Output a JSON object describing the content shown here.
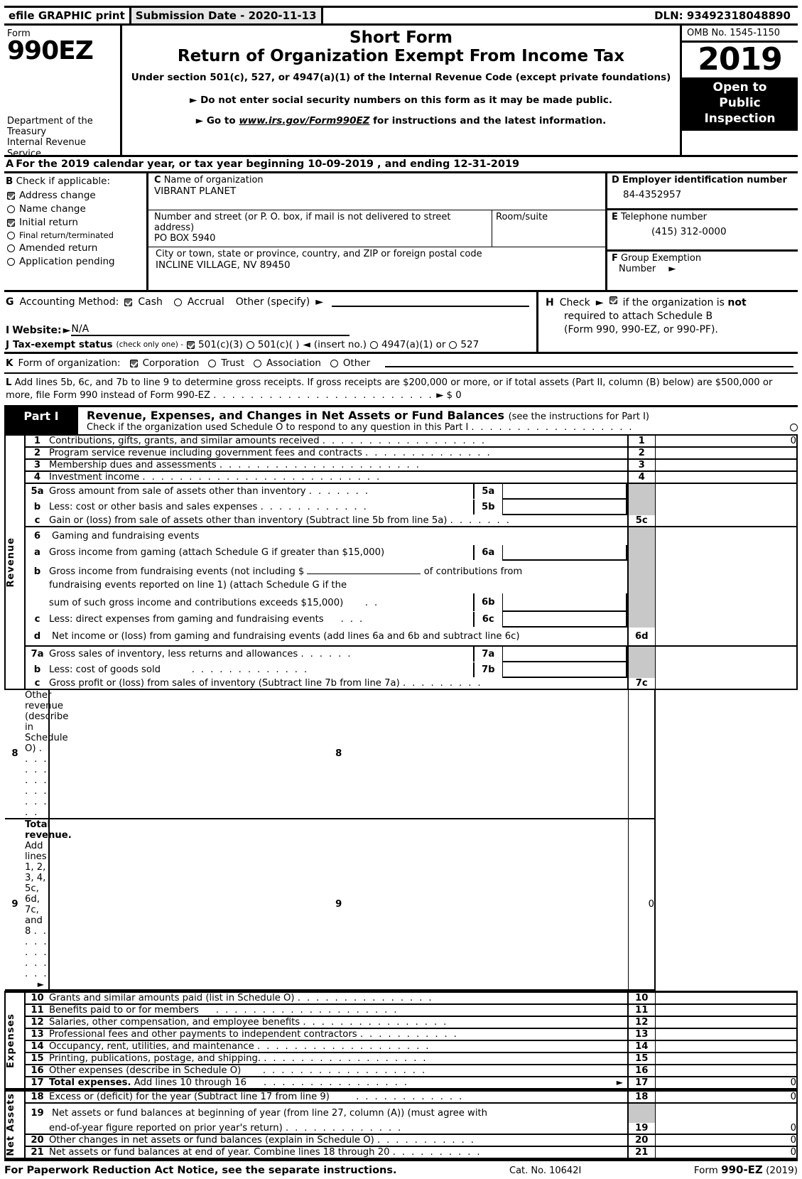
{
  "efile": {
    "graphic_print": "efile GRAPHIC print",
    "submission_date": "Submission Date - 2020-11-13",
    "dln": "DLN: 93492318048890"
  },
  "header": {
    "form_label": "Form",
    "form_number": "990EZ",
    "department": "Department of the Treasury Internal Revenue Service",
    "title_line1": "Short Form",
    "title_line2": "Return of Organization Exempt From Income Tax",
    "subtitle": "Under section 501(c), 527, or 4947(a)(1) of the Internal Revenue Code (except private foundations)",
    "notice1": "Do not enter social security numbers on this form as it may be made public.",
    "notice2_prefix": "Go to ",
    "notice2_link": "www.irs.gov/Form990EZ",
    "notice2_suffix": " for instructions and the latest information.",
    "omb": "OMB No. 1545-1150",
    "year": "2019",
    "open_to_public": "Open to Public Inspection"
  },
  "line_a": {
    "letter": "A",
    "text": "For the 2019 calendar year, or tax year beginning 10-09-2019 , and ending 12-31-2019"
  },
  "section_b": {
    "letter": "B",
    "heading": "Check if applicable:",
    "items": [
      {
        "label": "Address change",
        "checked": true
      },
      {
        "label": "Name change",
        "checked": false
      },
      {
        "label": "Initial return",
        "checked": true
      },
      {
        "label": "Final return/terminated",
        "checked": false
      },
      {
        "label": "Amended return",
        "checked": false
      },
      {
        "label": "Application pending",
        "checked": false
      }
    ]
  },
  "section_c": {
    "letter": "C",
    "name_caption": "Name of organization",
    "name_value": "VIBRANT PLANET",
    "street_caption": "Number and street (or P. O. box, if mail is not delivered to street address)",
    "street_value": "PO BOX 5940",
    "room_caption": "Room/suite",
    "room_value": "",
    "city_caption": "City or town, state or province, country, and ZIP or foreign postal code",
    "city_value": "INCLINE VILLAGE, NV  89450"
  },
  "section_d": {
    "letter": "D",
    "caption": "Employer identification number",
    "value": "84-4352957"
  },
  "section_e": {
    "letter": "E",
    "caption": "Telephone number",
    "value": "(415) 312-0000"
  },
  "section_f": {
    "letter": "F",
    "caption_line1": "Group Exemption",
    "caption_line2": "Number",
    "value": ""
  },
  "section_g": {
    "letter": "G",
    "label": "Accounting Method:",
    "cash": {
      "label": "Cash",
      "checked": true
    },
    "accrual": {
      "label": "Accrual",
      "checked": false
    },
    "other_label": "Other (specify)",
    "other_value": ""
  },
  "section_h": {
    "letter": "H",
    "check_label": "Check",
    "checked": true,
    "text_before": "if the organization is ",
    "text_bold": "not",
    "line2": "required to attach Schedule B",
    "line3": "(Form 990, 990-EZ, or 990-PF)."
  },
  "section_i": {
    "letter": "I",
    "label": "Website:",
    "value": "N/A"
  },
  "section_j": {
    "letter": "J",
    "label": "Tax-exempt status",
    "note": "(check only one) -",
    "options": [
      {
        "label": "501(c)(3)",
        "checked": true
      },
      {
        "label": "501(c)(   )",
        "checked": false
      },
      {
        "label": "4947(a)(1) or",
        "checked": false
      },
      {
        "label": "527",
        "checked": false
      }
    ],
    "insert_no": "(insert no.)"
  },
  "section_k": {
    "letter": "K",
    "label": "Form of organization:",
    "options": [
      {
        "label": "Corporation",
        "checked": true
      },
      {
        "label": "Trust",
        "checked": false
      },
      {
        "label": "Association",
        "checked": false
      },
      {
        "label": "Other",
        "checked": false
      }
    ]
  },
  "section_l": {
    "letter": "L",
    "text": "Add lines 5b, 6c, and 7b to line 9 to determine gross receipts. If gross receipts are $200,000 or more, or if total assets (Part II, column (B) below) are $500,000 or more, file Form 990 instead of Form 990-EZ",
    "value": "$ 0"
  },
  "part1": {
    "tag": "Part I",
    "title": "Revenue, Expenses, and Changes in Net Assets or Fund Balances",
    "title_note": "(see the instructions for Part I)",
    "schedule_o_check": "Check if the organization used Schedule O to respond to any question in this Part I",
    "schedule_o_checked": false,
    "revenue_label": "Revenue",
    "expenses_label": "Expenses",
    "net_assets_label": "Net Assets"
  },
  "revenue_rows": [
    {
      "no": "1",
      "line": "1",
      "desc": "Contributions, gifts, grants, and similar amounts received",
      "value": "0"
    },
    {
      "no": "2",
      "line": "2",
      "desc": "Program service revenue including government fees and contracts",
      "value": ""
    },
    {
      "no": "3",
      "line": "3",
      "desc": "Membership dues and assessments",
      "value": ""
    },
    {
      "no": "4",
      "line": "4",
      "desc": "Investment income",
      "value": ""
    }
  ],
  "row_5a": {
    "no": "5a",
    "desc": "Gross amount from sale of assets other than inventory",
    "box": "5a",
    "value": ""
  },
  "row_5b": {
    "no": "b",
    "desc": "Less: cost or other basis and sales expenses",
    "box": "5b",
    "value": ""
  },
  "row_5c": {
    "no": "c",
    "desc": "Gain or (loss) from sale of assets other than inventory (Subtract line 5b from line 5a)",
    "box": "5c",
    "value": ""
  },
  "row_6": {
    "no": "6",
    "desc": "Gaming and fundraising events"
  },
  "row_6a": {
    "no": "a",
    "desc": "Gross income from gaming (attach Schedule G if greater than $15,000)",
    "box": "6a",
    "value": ""
  },
  "row_6b": {
    "no": "b",
    "desc_1": "Gross income from fundraising events (not including $",
    "desc_2": "of contributions from",
    "desc_3": "fundraising events reported on line 1) (attach Schedule G if the",
    "desc_4": "sum of such gross income and contributions exceeds $15,000)",
    "box": "6b",
    "value": ""
  },
  "row_6c": {
    "no": "c",
    "desc": "Less: direct expenses from gaming and fundraising events",
    "box": "6c",
    "value": ""
  },
  "row_6d": {
    "no": "d",
    "desc": "Net income or (loss) from gaming and fundraising events (add lines 6a and 6b and subtract line 6c)",
    "box": "6d",
    "value": ""
  },
  "row_7a": {
    "no": "7a",
    "desc": "Gross sales of inventory, less returns and allowances",
    "box": "7a",
    "value": ""
  },
  "row_7b": {
    "no": "b",
    "desc": "Less: cost of goods sold",
    "box": "7b",
    "value": ""
  },
  "row_7c": {
    "no": "c",
    "desc": "Gross profit or (loss) from sales of inventory (Subtract line 7b from line 7a)",
    "box": "7c",
    "value": ""
  },
  "row_8": {
    "no": "8",
    "desc": "Other revenue (describe in Schedule O)",
    "box": "8",
    "value": ""
  },
  "row_9": {
    "no": "9",
    "desc_bold": "Total revenue.",
    "desc": " Add lines 1, 2, 3, 4, 5c, 6d, 7c, and 8",
    "box": "9",
    "value": "0"
  },
  "expense_rows": [
    {
      "no": "10",
      "desc": "Grants and similar amounts paid (list in Schedule O)",
      "value": ""
    },
    {
      "no": "11",
      "desc": "Benefits paid to or for members",
      "value": ""
    },
    {
      "no": "12",
      "desc": "Salaries, other compensation, and employee benefits",
      "value": ""
    },
    {
      "no": "13",
      "desc": "Professional fees and other payments to independent contractors",
      "value": ""
    },
    {
      "no": "14",
      "desc": "Occupancy, rent, utilities, and maintenance",
      "value": ""
    },
    {
      "no": "15",
      "desc": "Printing, publications, postage, and shipping.",
      "value": ""
    },
    {
      "no": "16",
      "desc": "Other expenses (describe in Schedule O)",
      "value": ""
    }
  ],
  "row_17": {
    "no": "17",
    "desc_bold": "Total expenses.",
    "desc": " Add lines 10 through 16",
    "box": "17",
    "value": "0"
  },
  "row_18": {
    "no": "18",
    "desc": "Excess or (deficit) for the year (Subtract line 17 from line 9)",
    "box": "18",
    "value": "0"
  },
  "row_19": {
    "no": "19",
    "desc_1": "Net assets or fund balances at beginning of year (from line 27, column (A)) (must agree with",
    "desc_2": "end-of-year figure reported on prior year's return)",
    "box": "19",
    "value": "0"
  },
  "row_20": {
    "no": "20",
    "desc": "Other changes in net assets or fund balances (explain in Schedule O)",
    "box": "20",
    "value": "0"
  },
  "row_21": {
    "no": "21",
    "desc": "Net assets or fund balances at end of year. Combine lines 18 through 20",
    "box": "21",
    "value": "0"
  },
  "footer": {
    "notice": "For Paperwork Reduction Act Notice, see the separate instructions.",
    "cat": "Cat. No. 10642I",
    "form_prefix": "Form ",
    "form_bold": "990-EZ",
    "form_year": " (2019)"
  }
}
